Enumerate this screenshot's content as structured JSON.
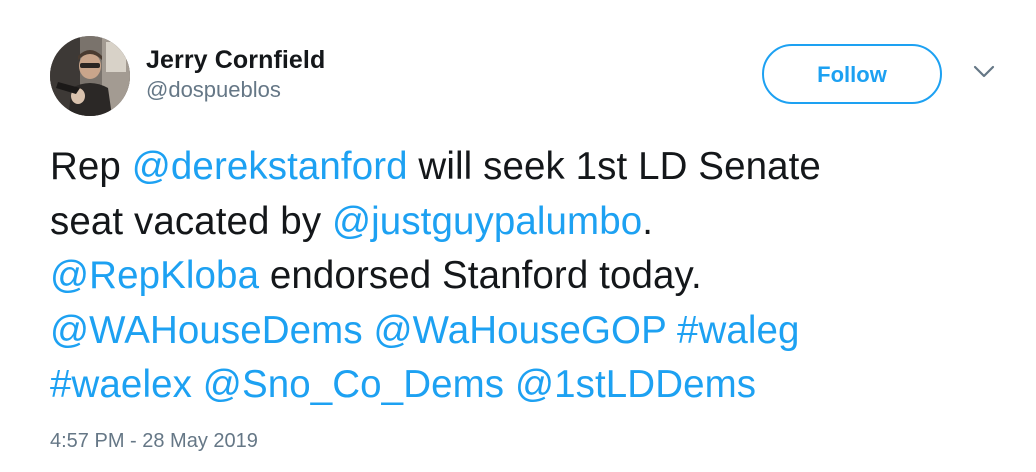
{
  "author": {
    "display_name": "Jerry Cornfield",
    "handle": "@dospueblos"
  },
  "follow_button": {
    "label": "Follow"
  },
  "menu": {
    "icon": "chevron-down-icon"
  },
  "tweet": {
    "lines": [
      [
        {
          "type": "text",
          "text": "Rep "
        },
        {
          "type": "mention",
          "text": "@derekstanford"
        },
        {
          "type": "text",
          "text": " will seek 1st LD Senate"
        }
      ],
      [
        {
          "type": "text",
          "text": "seat vacated by "
        },
        {
          "type": "mention",
          "text": "@justguypalumbo"
        },
        {
          "type": "text",
          "text": "."
        }
      ],
      [
        {
          "type": "mention",
          "text": "@RepKloba"
        },
        {
          "type": "text",
          "text": " endorsed Stanford today."
        }
      ],
      [
        {
          "type": "mention",
          "text": "@WAHouseDems"
        },
        {
          "type": "text",
          "text": " "
        },
        {
          "type": "mention",
          "text": "@WaHouseGOP"
        },
        {
          "type": "text",
          "text": " "
        },
        {
          "type": "hashtag",
          "text": "#waleg"
        }
      ],
      [
        {
          "type": "hashtag",
          "text": "#waelex"
        },
        {
          "type": "text",
          "text": " "
        },
        {
          "type": "mention",
          "text": "@Sno_Co_Dems"
        },
        {
          "type": "text",
          "text": " "
        },
        {
          "type": "mention",
          "text": "@1stLDDems"
        }
      ]
    ]
  },
  "timestamp": "4:57 PM - 28 May 2019",
  "colors": {
    "link": "#1da1f2",
    "text": "#14171a",
    "secondary": "#657786"
  }
}
